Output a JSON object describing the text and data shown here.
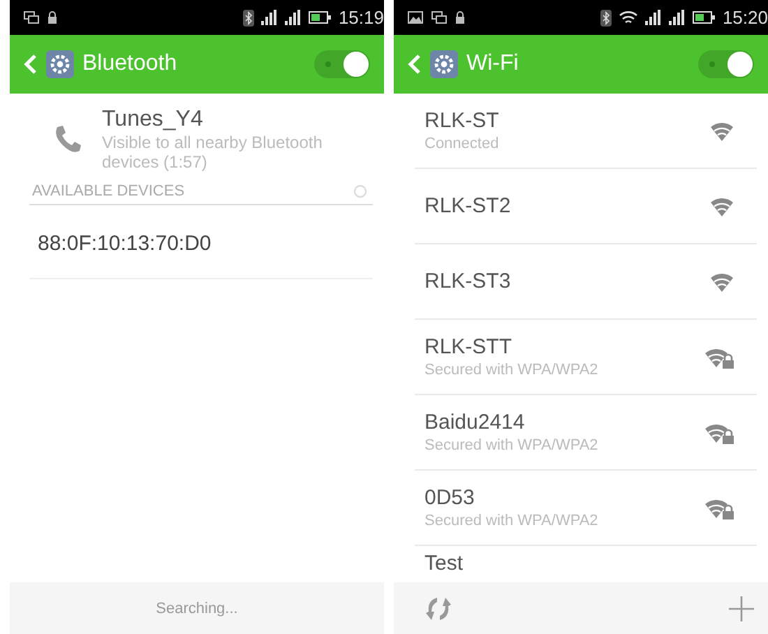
{
  "screens": [
    {
      "kind": "bluetooth",
      "status_bar": {
        "time": "15:19",
        "wifi": false,
        "picture_icon": false
      },
      "header": {
        "title": "Bluetooth",
        "switch_on": true
      },
      "this_device": {
        "name": "Tunes_Y4",
        "subtitle": "Visible to all nearby Bluetooth devices (1:57)"
      },
      "section": {
        "title": "AVAILABLE DEVICES"
      },
      "devices": [
        {
          "name": "88:0F:10:13:70:D0"
        }
      ],
      "footer": {
        "text": "Searching..."
      }
    },
    {
      "kind": "wifi",
      "status_bar": {
        "time": "15:20",
        "wifi": true,
        "picture_icon": true
      },
      "header": {
        "title": "Wi-Fi",
        "switch_on": true
      },
      "networks": [
        {
          "name": "RLK-ST",
          "status": "Connected",
          "kind": "open"
        },
        {
          "name": "RLK-ST2",
          "kind": "open"
        },
        {
          "name": "RLK-ST3",
          "kind": "open"
        },
        {
          "name": "RLK-STT",
          "status": "Secured with WPA/WPA2",
          "kind": "locked"
        },
        {
          "name": "Baidu2414",
          "status": "Secured with WPA/WPA2",
          "kind": "locked"
        },
        {
          "name": "0D53",
          "status": "Secured with WPA/WPA2",
          "kind": "locked"
        },
        {
          "name": "Test",
          "kind": "partial"
        }
      ]
    }
  ]
}
